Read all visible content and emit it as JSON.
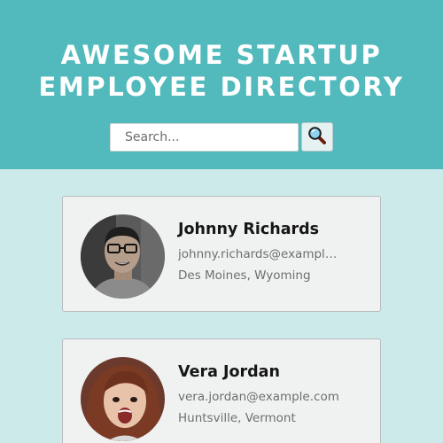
{
  "header": {
    "title_line1": "AWESOME STARTUP",
    "title_line2": "EMPLOYEE DIRECTORY",
    "background_color": "#52babc"
  },
  "search": {
    "placeholder": "Search...",
    "value": "",
    "button_icon": "magnifying-glass-icon"
  },
  "employees": [
    {
      "name": "Johnny Richards",
      "email": "johnny.richards@example.com",
      "location": "Des Moines, Wyoming"
    },
    {
      "name": "Vera Jordan",
      "email": "vera.jordan@example.com",
      "location": "Huntsville, Vermont"
    }
  ],
  "colors": {
    "page_background": "#cdeaea",
    "card_background": "#f0f2f2"
  }
}
